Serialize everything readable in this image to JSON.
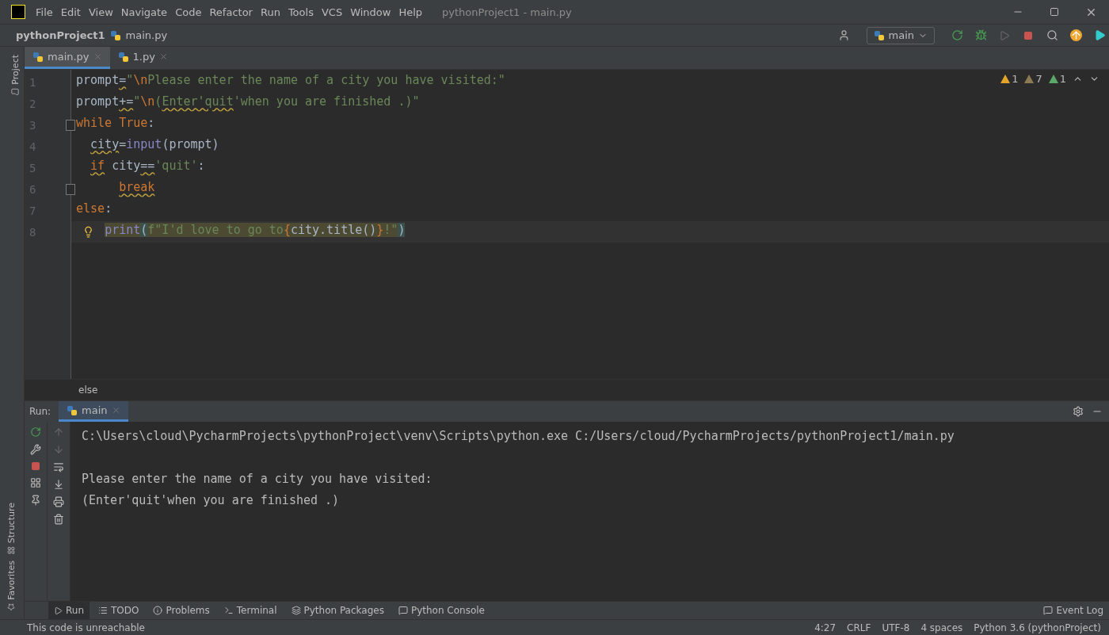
{
  "menu": [
    "File",
    "Edit",
    "View",
    "Navigate",
    "Code",
    "Refactor",
    "Run",
    "Tools",
    "VCS",
    "Window",
    "Help"
  ],
  "window": {
    "title": "pythonProject1 - main.py"
  },
  "breadcrumb": {
    "project": "pythonProject1",
    "file": "main.py"
  },
  "run_config": "main",
  "tabs": [
    {
      "label": "main.py",
      "selected": true
    },
    {
      "label": "1.py",
      "selected": false
    }
  ],
  "left_stripe": [
    "Project",
    "Structure",
    "Favorites"
  ],
  "inspections": [
    {
      "kind": "warning",
      "count": "1"
    },
    {
      "kind": "weak",
      "count": "7"
    },
    {
      "kind": "typo",
      "count": "1"
    }
  ],
  "code": [
    {
      "number": "1",
      "tokens": [
        {
          "kind": "plain",
          "text": "prompt"
        },
        {
          "kind": "plain",
          "text": "=",
          "squiggle": true
        },
        {
          "kind": "string",
          "text": "\""
        },
        {
          "kind": "escape",
          "text": "\\n"
        },
        {
          "kind": "string",
          "text": "Please enter the name of a city you have visited:\""
        }
      ]
    },
    {
      "number": "2",
      "tokens": [
        {
          "kind": "plain",
          "text": "prompt"
        },
        {
          "kind": "plain",
          "text": "+=",
          "squiggle": true
        },
        {
          "kind": "string",
          "text": "\""
        },
        {
          "kind": "escape",
          "text": "\\n"
        },
        {
          "kind": "string",
          "text": "("
        },
        {
          "kind": "string",
          "text": "Enter'quit",
          "squiggle": true
        },
        {
          "kind": "string",
          "text": "'when you are finished .)\""
        }
      ]
    },
    {
      "number": "3",
      "fold": true,
      "tokens": [
        {
          "kind": "keyword",
          "text": "while True"
        },
        {
          "kind": "plain",
          "text": ":"
        }
      ]
    },
    {
      "number": "4",
      "tokens": [
        {
          "kind": "plain",
          "text": "  city",
          "squiggle": true
        },
        {
          "kind": "plain",
          "text": "="
        },
        {
          "kind": "builtin",
          "text": "input"
        },
        {
          "kind": "plain",
          "text": "(prompt)"
        }
      ]
    },
    {
      "number": "5",
      "tokens": [
        {
          "kind": "keyword",
          "text": "  if",
          "squiggle": true
        },
        {
          "kind": "plain",
          "text": " city"
        },
        {
          "kind": "plain",
          "text": "==",
          "squiggle": true
        },
        {
          "kind": "string",
          "text": "'quit'"
        },
        {
          "kind": "plain",
          "text": ":"
        }
      ]
    },
    {
      "number": "6",
      "fold": true,
      "tokens": [
        {
          "kind": "keyword",
          "text": "      break",
          "squiggle": true
        }
      ]
    },
    {
      "number": "7",
      "tokens": [
        {
          "kind": "keyword",
          "text": "else"
        },
        {
          "kind": "plain",
          "text": ":"
        }
      ]
    },
    {
      "number": "8",
      "current": true,
      "bulb": true,
      "tokens": [
        {
          "kind": "builtin",
          "text": "    print"
        },
        {
          "kind": "paren",
          "text": "("
        },
        {
          "kind": "string",
          "text": "f\"I'd love to go to"
        },
        {
          "kind": "keyword",
          "text": "{"
        },
        {
          "kind": "plain",
          "text": "city.title()"
        },
        {
          "kind": "keyword",
          "text": "}"
        },
        {
          "kind": "string",
          "text": "!\""
        },
        {
          "kind": "paren",
          "text": ")"
        }
      ]
    }
  ],
  "editor_breadcrumb": "else",
  "run_panel": {
    "label": "Run:",
    "tab": "main",
    "output": [
      "C:\\Users\\cloud\\PycharmProjects\\pythonProject\\venv\\Scripts\\python.exe C:/Users/cloud/PycharmProjects/pythonProject1/main.py",
      "Please enter the name of a city you have visited:",
      "(Enter'quit'when you are finished .)"
    ]
  },
  "tool_windows": [
    {
      "kind": "run",
      "label": "Run",
      "selected": true
    },
    {
      "kind": "todo",
      "label": "TODO",
      "selected": false
    },
    {
      "kind": "problems",
      "label": "Problems",
      "selected": false
    },
    {
      "kind": "terminal",
      "label": "Terminal",
      "selected": false
    },
    {
      "kind": "packages",
      "label": "Python Packages",
      "selected": false
    },
    {
      "kind": "console",
      "label": "Python Console",
      "selected": false
    }
  ],
  "event_log": "Event Log",
  "status_bar": {
    "message": "This code is unreachable",
    "items": [
      "4:27",
      "CRLF",
      "UTF-8",
      "4 spaces",
      "Python 3.6 (pythonProject)"
    ]
  }
}
